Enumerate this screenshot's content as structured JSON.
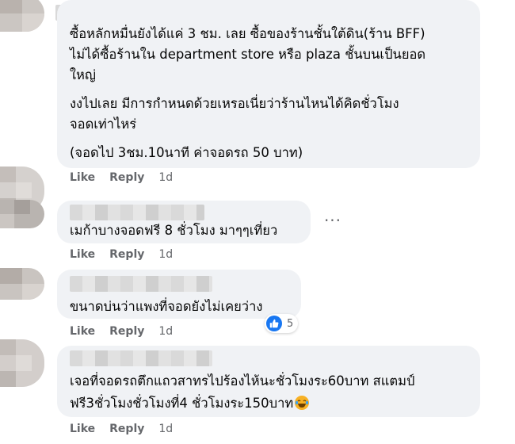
{
  "comments": [
    {
      "lines": [
        "ซื้อหลักหมื่นยังได้แค่ 3 ชม. เลย ซื้อของร้านชั้นใต้ดิน(ร้าน BFF)",
        "ไม่ได้ซื้อร้านใน department store หรือ plaza ชั้นบนเป็นยอด",
        "ใหญ่"
      ],
      "paragraph2": [
        "งงไปเลย มีการกำหนดด้วยเหรอเนี่ยว่าร้านไหนได้คิดชั่วโมง",
        "จอดเท่าไหร่"
      ],
      "paragraph3": "(จอดไป 3ชม.10นาที ค่าจอดรถ 50 บาท)",
      "like": "Like",
      "reply": "Reply",
      "time": "1d"
    },
    {
      "text": "เมก้าบางจอดฟรี 8 ชั่วโมง มาๆๆเที่ยว",
      "more": "···",
      "like": "Like",
      "reply": "Reply",
      "time": "1d"
    },
    {
      "text": "ขนาดบ่นว่าแพงที่จอดยังไม่เคยว่าง",
      "reaction_count": "5",
      "like": "Like",
      "reply": "Reply",
      "time": "1d"
    },
    {
      "lines": [
        "เจอที่จอดรถตึกแถวสาทรไปร้องไห้นะชั่วโมงระ60บาท สแตมป์",
        "ฟรี3ชั่วโมงชั่วโมงที่4 ชั่วโมงระ150บาท"
      ],
      "emoji": "laughing-emoji",
      "like": "Like",
      "reply": "Reply",
      "time": "1d"
    }
  ],
  "colors": {
    "bubble": "#f0f2f5",
    "meta": "#65676b",
    "like_blue": "#1877f2"
  }
}
